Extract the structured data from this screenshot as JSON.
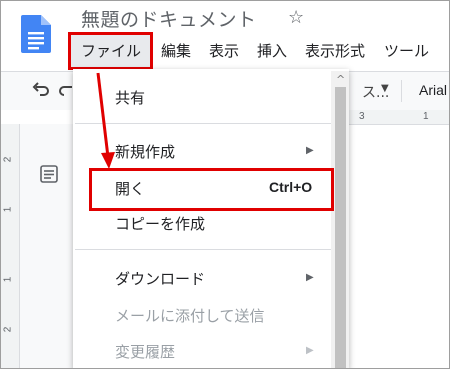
{
  "document": {
    "title": "無題のドキュメント",
    "icons": {
      "logo": "google-docs-logo",
      "star": "star-outline-icon"
    }
  },
  "menubar": {
    "items": [
      "ファイル",
      "編集",
      "表示",
      "挿入",
      "表示形式",
      "ツール"
    ],
    "highlighted": "ファイル"
  },
  "toolbar": {
    "zoom_partial": "ス...",
    "font_partial": "Arial"
  },
  "ruler": {
    "top_marks": [
      "3",
      "1"
    ],
    "left_marks": [
      "2",
      "1",
      "1",
      "2"
    ]
  },
  "file_menu": {
    "items": [
      {
        "label": "共有",
        "enabled": true,
        "submenu": false
      },
      {
        "label": "新規作成",
        "enabled": true,
        "submenu": true
      },
      {
        "label": "開く",
        "enabled": true,
        "shortcut": "Ctrl+O",
        "highlighted": true
      },
      {
        "label": "コピーを作成",
        "enabled": true,
        "submenu": false
      },
      {
        "label": "ダウンロード",
        "enabled": true,
        "submenu": true
      },
      {
        "label": "メールに添付して送信",
        "enabled": false,
        "submenu": false
      },
      {
        "label": "変更履歴",
        "enabled": false,
        "submenu": true
      }
    ]
  },
  "colors": {
    "annotation_red": "#e00000",
    "docs_blue": "#4285f4"
  }
}
